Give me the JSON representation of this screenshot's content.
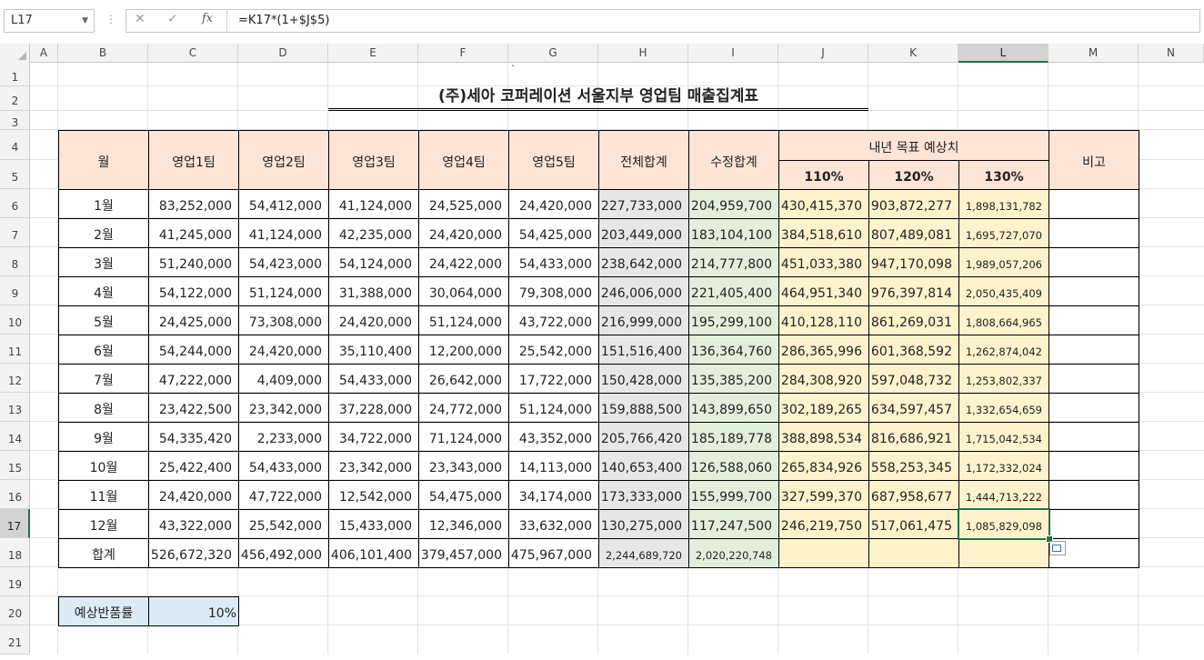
{
  "formula_bar": {
    "name_box": "L17",
    "formula": "=K17*(1+$J$5)",
    "fx": "fx"
  },
  "columns": [
    "A",
    "B",
    "C",
    "D",
    "E",
    "F",
    "G",
    "H",
    "I",
    "J",
    "K",
    "L",
    "M",
    "N"
  ],
  "selected_column": "L",
  "rows": [
    "1",
    "2",
    "3",
    "4",
    "5",
    "6",
    "7",
    "8",
    "9",
    "10",
    "11",
    "12",
    "13",
    "14",
    "15",
    "16",
    "17",
    "18",
    "19",
    "20",
    "21"
  ],
  "selected_row": "17",
  "sheet": {
    "stray_mark": "`",
    "title": "(주)세아 코퍼레이션 서울지부 영업팀 매출집계표",
    "headers": {
      "month": "월",
      "team1": "영업1팀",
      "team2": "영업2팀",
      "team3": "영업3팀",
      "team4": "영업4팀",
      "team5": "영업5팀",
      "total": "전체합계",
      "adjusted": "수정합계",
      "forecast": "내년 목표 예상치",
      "p110": "110%",
      "p120": "120%",
      "p130": "130%",
      "note": "비고"
    },
    "data_rows": [
      [
        "1월",
        "83,252,000",
        "54,412,000",
        "41,124,000",
        "24,525,000",
        "24,420,000",
        "227,733,000",
        "204,959,700",
        "430,415,370",
        "903,872,277",
        "1,898,131,782"
      ],
      [
        "2월",
        "41,245,000",
        "41,124,000",
        "42,235,000",
        "24,420,000",
        "54,425,000",
        "203,449,000",
        "183,104,100",
        "384,518,610",
        "807,489,081",
        "1,695,727,070"
      ],
      [
        "3월",
        "51,240,000",
        "54,423,000",
        "54,124,000",
        "24,422,000",
        "54,433,000",
        "238,642,000",
        "214,777,800",
        "451,033,380",
        "947,170,098",
        "1,989,057,206"
      ],
      [
        "4월",
        "54,122,000",
        "51,124,000",
        "31,388,000",
        "30,064,000",
        "79,308,000",
        "246,006,000",
        "221,405,400",
        "464,951,340",
        "976,397,814",
        "2,050,435,409"
      ],
      [
        "5월",
        "24,425,000",
        "73,308,000",
        "24,420,000",
        "51,124,000",
        "43,722,000",
        "216,999,000",
        "195,299,100",
        "410,128,110",
        "861,269,031",
        "1,808,664,965"
      ],
      [
        "6월",
        "54,244,000",
        "24,420,000",
        "35,110,400",
        "12,200,000",
        "25,542,000",
        "151,516,400",
        "136,364,760",
        "286,365,996",
        "601,368,592",
        "1,262,874,042"
      ],
      [
        "7월",
        "47,222,000",
        "4,409,000",
        "54,433,000",
        "26,642,000",
        "17,722,000",
        "150,428,000",
        "135,385,200",
        "284,308,920",
        "597,048,732",
        "1,253,802,337"
      ],
      [
        "8월",
        "23,422,500",
        "23,342,000",
        "37,228,000",
        "24,772,000",
        "51,124,000",
        "159,888,500",
        "143,899,650",
        "302,189,265",
        "634,597,457",
        "1,332,654,659"
      ],
      [
        "9월",
        "54,335,420",
        "2,233,000",
        "34,722,000",
        "71,124,000",
        "43,352,000",
        "205,766,420",
        "185,189,778",
        "388,898,534",
        "816,686,921",
        "1,715,042,534"
      ],
      [
        "10월",
        "25,422,400",
        "54,433,000",
        "23,342,000",
        "23,343,000",
        "14,113,000",
        "140,653,400",
        "126,588,060",
        "265,834,926",
        "558,253,345",
        "1,172,332,024"
      ],
      [
        "11월",
        "24,420,000",
        "47,722,000",
        "12,542,000",
        "54,475,000",
        "34,174,000",
        "173,333,000",
        "155,999,700",
        "327,599,370",
        "687,958,677",
        "1,444,713,222"
      ],
      [
        "12월",
        "43,322,000",
        "25,542,000",
        "15,433,000",
        "12,346,000",
        "33,632,000",
        "130,275,000",
        "117,247,500",
        "246,219,750",
        "517,061,475",
        "1,085,829,098"
      ]
    ],
    "total_row": [
      "합계",
      "526,672,320",
      "456,492,000",
      "406,101,400",
      "379,457,000",
      "475,967,000",
      "2,244,689,720",
      "2,020,220,748",
      "",
      "",
      ""
    ],
    "return_rate_label": "예상반품률",
    "return_rate_value": "10%"
  },
  "colors": {
    "header_fill": "#fce4d6",
    "total_fill": "#e7e7e7",
    "adjusted_fill": "#e2efda",
    "forecast_fill": "#fff2cc",
    "rate_fill": "#ddebf7",
    "selection": "#217346"
  }
}
